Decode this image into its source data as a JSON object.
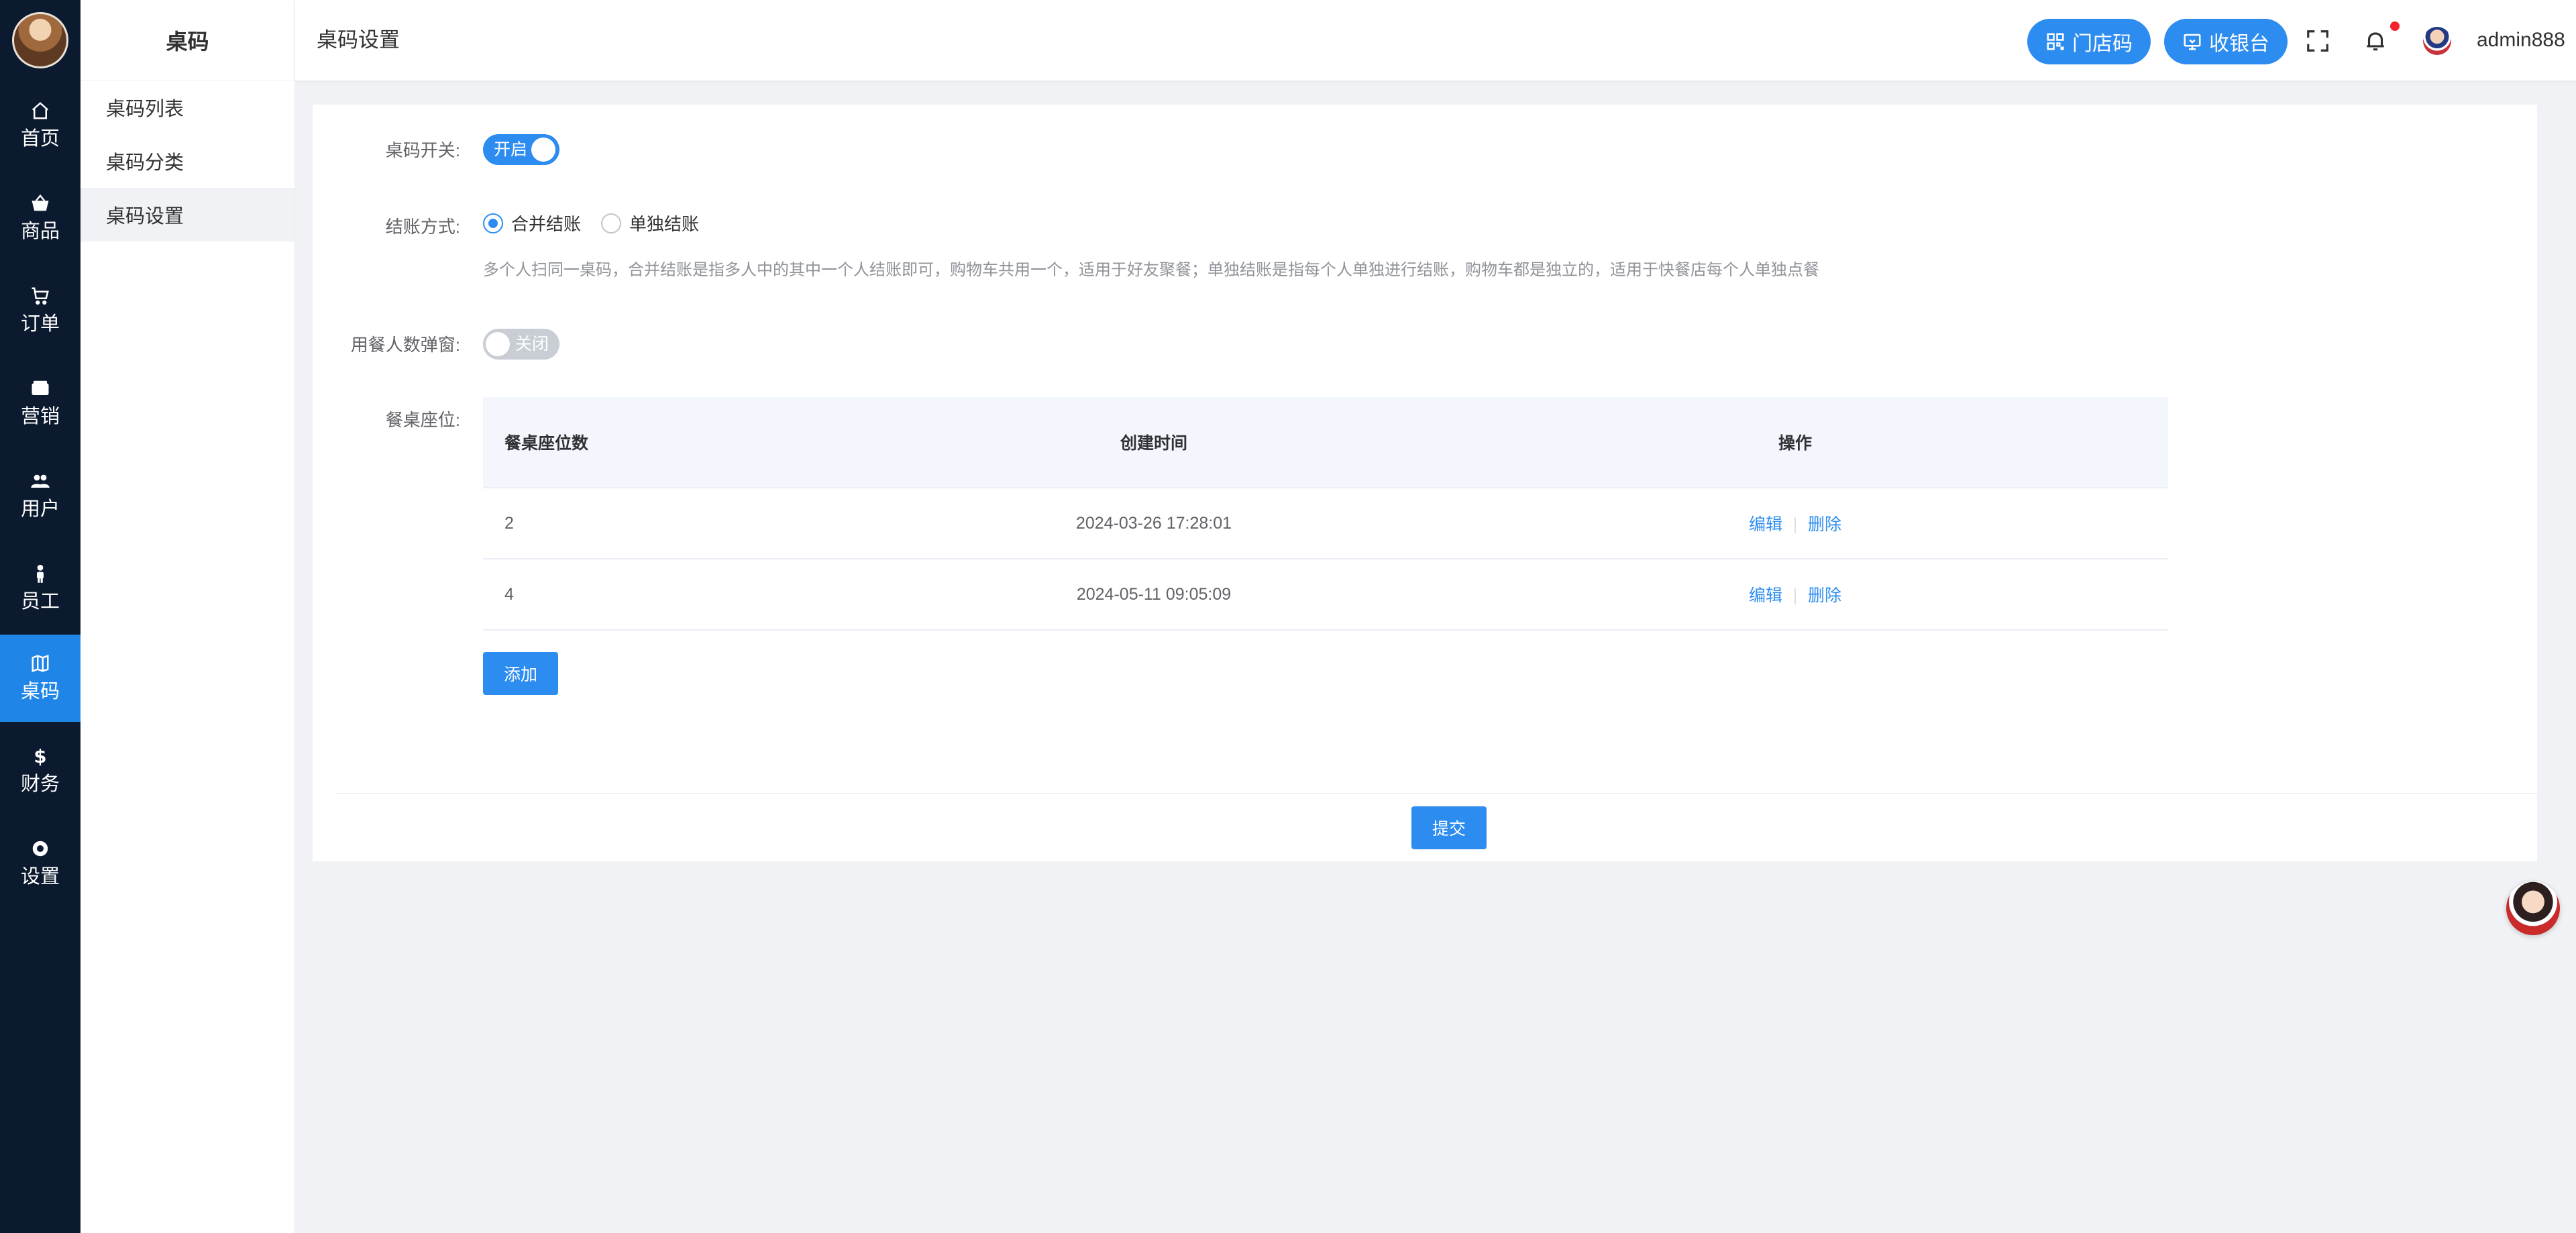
{
  "nav_rail": {
    "items": [
      {
        "label": "首页",
        "icon": "home-icon"
      },
      {
        "label": "商品",
        "icon": "basket-icon"
      },
      {
        "label": "订单",
        "icon": "cart-icon"
      },
      {
        "label": "营销",
        "icon": "wallet-icon"
      },
      {
        "label": "用户",
        "icon": "users-icon"
      },
      {
        "label": "员工",
        "icon": "person-icon"
      },
      {
        "label": "桌码",
        "icon": "map-icon",
        "active": true
      },
      {
        "label": "财务",
        "icon": "dollar-icon"
      },
      {
        "label": "设置",
        "icon": "gear-icon"
      }
    ]
  },
  "submenu": {
    "title": "桌码",
    "items": [
      {
        "label": "桌码列表"
      },
      {
        "label": "桌码分类"
      },
      {
        "label": "桌码设置",
        "active": true
      }
    ]
  },
  "header": {
    "page_title": "桌码设置",
    "store_code_label": "门店码",
    "cashier_label": "收银台",
    "username": "admin888"
  },
  "form": {
    "table_code_switch": {
      "label": "桌码开关:",
      "state_text": "开启",
      "on": true
    },
    "checkout_mode": {
      "label": "结账方式:",
      "options": [
        "合并结账",
        "单独结账"
      ],
      "selected": "合并结账",
      "hint": "多个人扫同一桌码，合并结账是指多人中的其中一个人结账即可，购物车共用一个，适用于好友聚餐；单独结账是指每个人单独进行结账，购物车都是独立的，适用于快餐店每个人单独点餐"
    },
    "diner_popup_switch": {
      "label": "用餐人数弹窗:",
      "state_text": "关闭",
      "on": false
    },
    "seats": {
      "label": "餐桌座位:",
      "columns": [
        "餐桌座位数",
        "创建时间",
        "操作"
      ],
      "rows": [
        {
          "seats": "2",
          "created": "2024-03-26 17:28:01",
          "edit": "编辑",
          "delete": "删除"
        },
        {
          "seats": "4",
          "created": "2024-05-11 09:05:09",
          "edit": "编辑",
          "delete": "删除"
        }
      ],
      "add_label": "添加"
    },
    "submit_label": "提交"
  },
  "colors": {
    "accent": "#2d8cf0",
    "rail_bg": "#0b1a2f",
    "rail_active": "#1f86e8"
  }
}
